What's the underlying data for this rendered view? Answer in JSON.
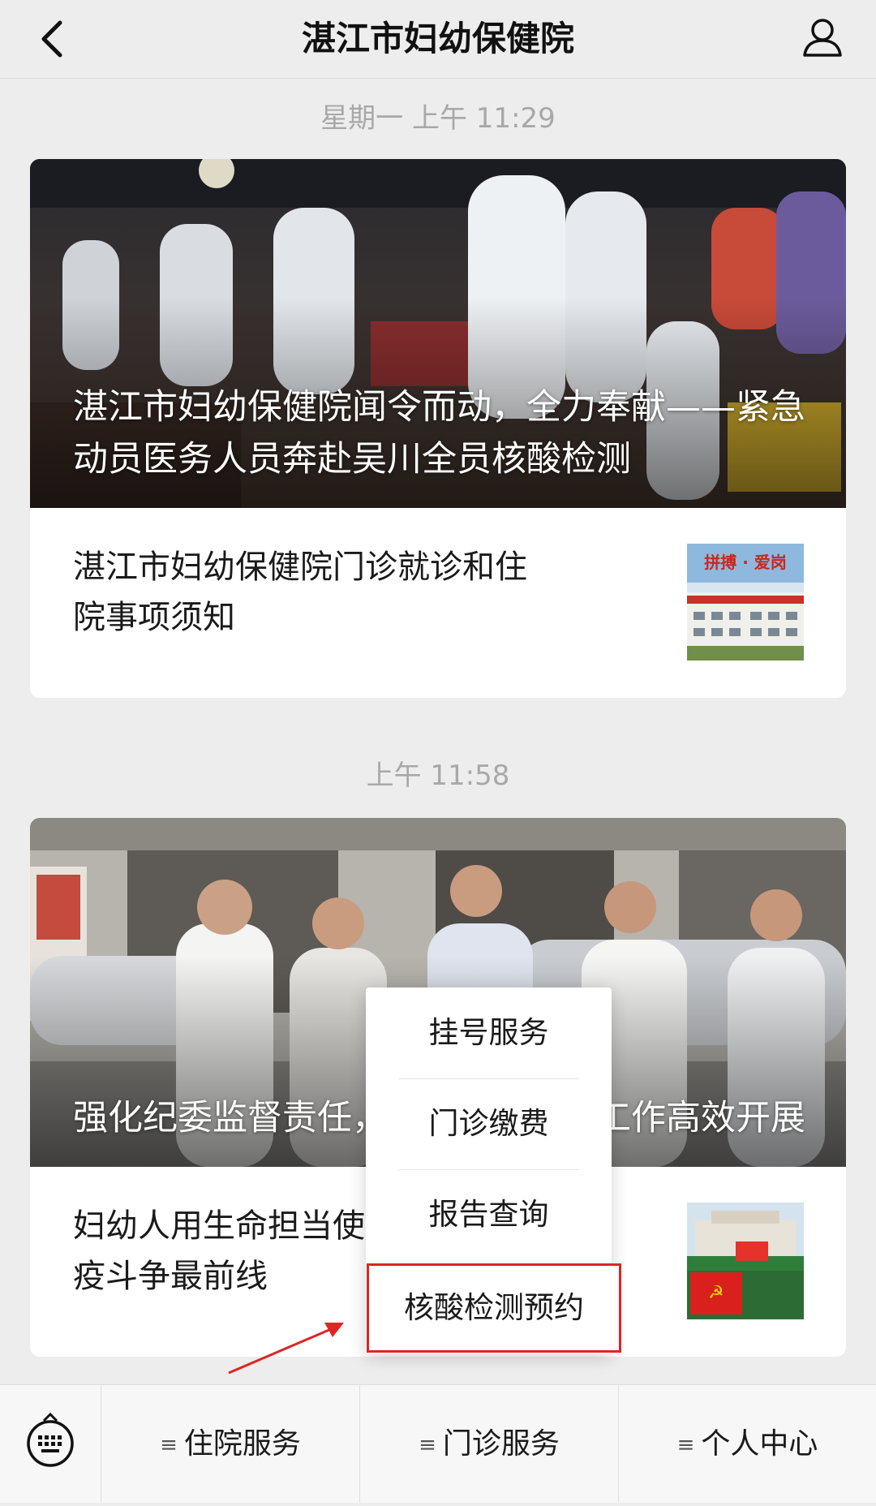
{
  "header": {
    "title": "湛江市妇幼保健院"
  },
  "messages": [
    {
      "timestamp": "星期一 上午 11:29",
      "cover_title": "湛江市妇幼保健院闻令而动，全力奉献——紧急动员医务人员奔赴吴川全员核酸检测",
      "sub_title": "湛江市妇幼保健院门诊就诊和住院事项须知",
      "thumb_caption": "拼搏 · 爱岗"
    },
    {
      "timestamp": "上午 11:58",
      "cover_title": "强化纪委监督责任，保障疫情防控工作高效开展",
      "sub_title": "妇幼人用生命担当使命，坚守抗疫斗争最前线"
    }
  ],
  "popup_menu": {
    "items": [
      "挂号服务",
      "门诊缴费",
      "报告查询"
    ],
    "highlighted": "核酸检测预约",
    "highlight_color": "#e02424"
  },
  "bottom_menu": {
    "items": [
      {
        "label": "住院服务",
        "icon": "menu-lines-icon"
      },
      {
        "label": "门诊服务",
        "icon": "menu-lines-icon"
      },
      {
        "label": "个人中心",
        "icon": "menu-lines-icon"
      }
    ],
    "keyboard_icon": "keyboard-icon"
  }
}
